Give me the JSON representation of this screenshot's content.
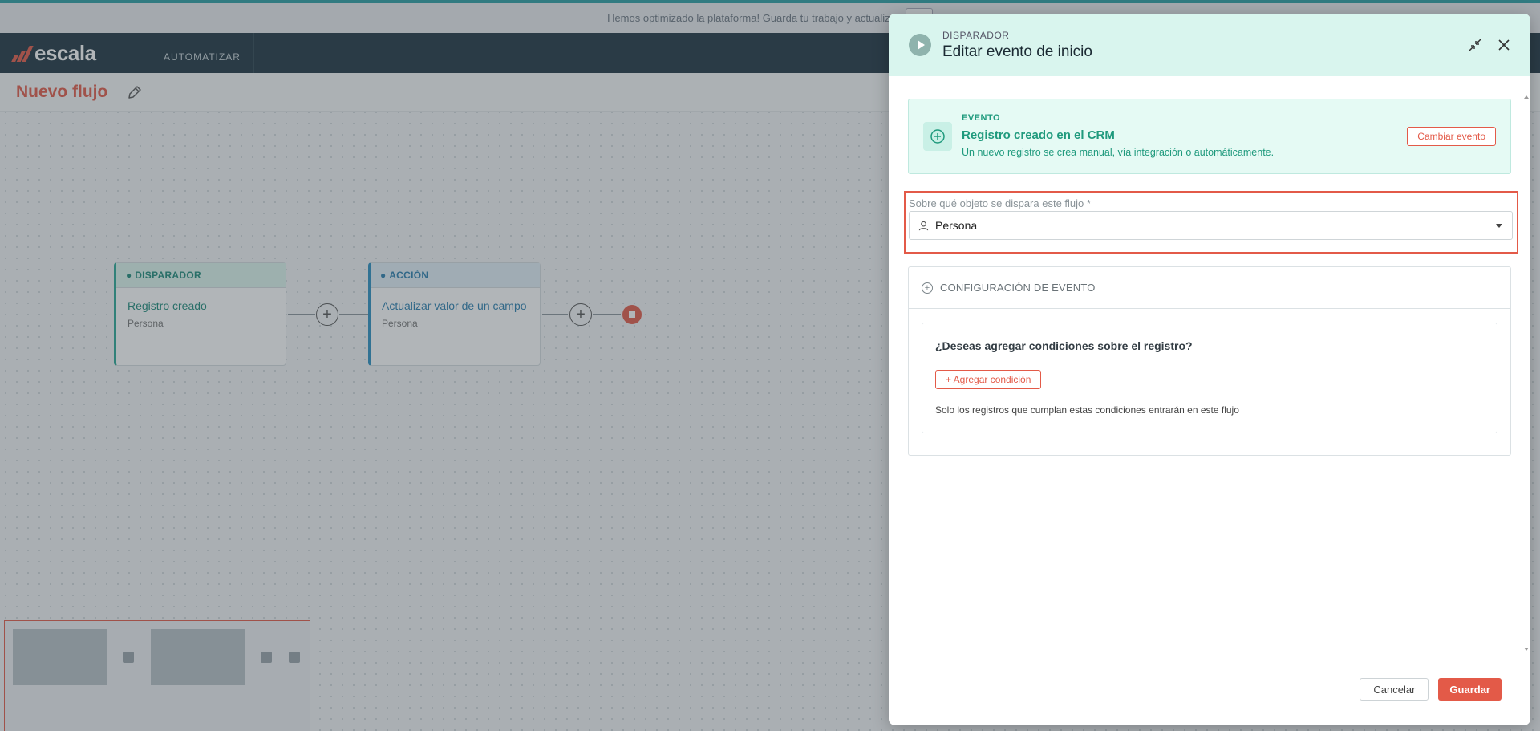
{
  "banner": {
    "message": "Hemos optimizado la plataforma! Guarda tu trabajo y actualiza",
    "button_label": ""
  },
  "navbar": {
    "logo_text": "escala",
    "nav_item": "AUTOMATIZAR"
  },
  "flow": {
    "title": "Nuevo flujo",
    "nodes": [
      {
        "type_label": "DISPARADOR",
        "title": "Registro creado",
        "subtitle": "Persona"
      },
      {
        "type_label": "ACCIÓN",
        "title": "Actualizar valor de un campo",
        "subtitle": "Persona"
      }
    ]
  },
  "modal": {
    "eyebrow": "DISPARADOR",
    "title": "Editar evento de inicio",
    "event": {
      "label": "EVENTO",
      "name": "Registro creado en el CRM",
      "description": "Un nuevo registro se crea manual, vía integración o automáticamente.",
      "change_button": "Cambiar evento"
    },
    "object_field": {
      "label": "Sobre qué objeto se dispara este flujo *",
      "value": "Persona"
    },
    "config": {
      "header": "CONFIGURACIÓN DE EVENTO",
      "question": "¿Deseas agregar condiciones sobre el registro?",
      "add_button": "+ Agregar condición",
      "note": "Solo los registros que cumplan estas condiciones entrarán en este flujo"
    },
    "footer": {
      "cancel": "Cancelar",
      "save": "Guardar"
    }
  },
  "colors": {
    "brand": "#e35a48",
    "navbar": "#1f3541",
    "trigger": "#2ba897",
    "action": "#2b8fc2",
    "modal_header": "#d9f5ee"
  }
}
